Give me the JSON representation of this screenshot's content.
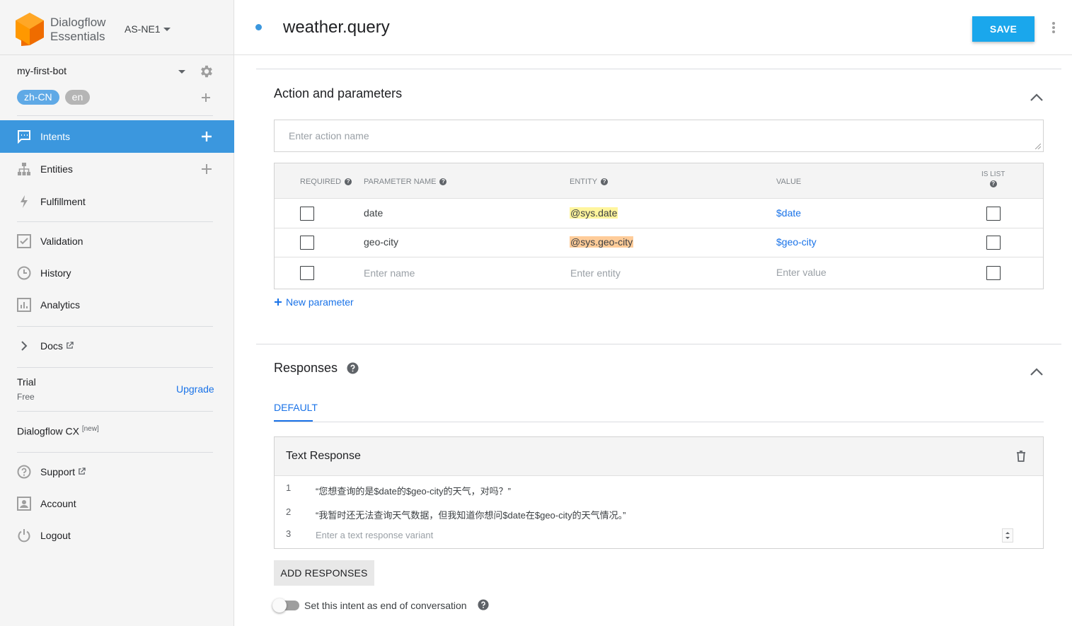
{
  "brand": {
    "line1": "Dialogflow",
    "line2": "Essentials",
    "region": "AS-NE1"
  },
  "agent": {
    "name": "my-first-bot",
    "languages": [
      "zh-CN",
      "en"
    ]
  },
  "nav": {
    "intents": "Intents",
    "entities": "Entities",
    "fulfillment": "Fulfillment",
    "validation": "Validation",
    "history": "History",
    "analytics": "Analytics",
    "docs": "Docs",
    "support": "Support",
    "account": "Account",
    "logout": "Logout"
  },
  "plan": {
    "title": "Trial",
    "subtitle": "Free",
    "upgrade": "Upgrade",
    "cx": "Dialogflow CX",
    "cx_badge": "[new]"
  },
  "header": {
    "intent_name": "weather.query",
    "save_label": "SAVE"
  },
  "action_section": {
    "title": "Action and parameters",
    "action_placeholder": "Enter action name",
    "columns": {
      "required": "REQUIRED",
      "parameter_name": "PARAMETER NAME",
      "entity": "ENTITY",
      "value": "VALUE",
      "is_list_1": "IS LIST"
    },
    "rows": [
      {
        "name": "date",
        "entity": "@sys.date",
        "value": "$date"
      },
      {
        "name": "geo-city",
        "entity": "@sys.geo-city",
        "value": "$geo-city"
      }
    ],
    "empty_row": {
      "name": "Enter name",
      "entity": "Enter entity",
      "value": "Enter value"
    },
    "new_parameter": "New parameter"
  },
  "responses_section": {
    "title": "Responses",
    "tab": "DEFAULT",
    "box_title": "Text Response",
    "lines": [
      {
        "num": "1",
        "text": "“您想查询的是$date的$geo-city的天气，对吗？”"
      },
      {
        "num": "2",
        "text": "“我暂时还无法查询天气数据，但我知道你想问$date在$geo-city的天气情况。”"
      },
      {
        "num": "3",
        "placeholder": "Enter a text response variant"
      }
    ],
    "add_responses": "ADD RESPONSES",
    "end_conversation": "Set this intent as end of conversation"
  },
  "colors": {
    "accent": "#3b97de",
    "save": "#1aa7ec",
    "entity_date": "#fff59d",
    "entity_geo": "#ffcc99",
    "link": "#1a73e8"
  }
}
